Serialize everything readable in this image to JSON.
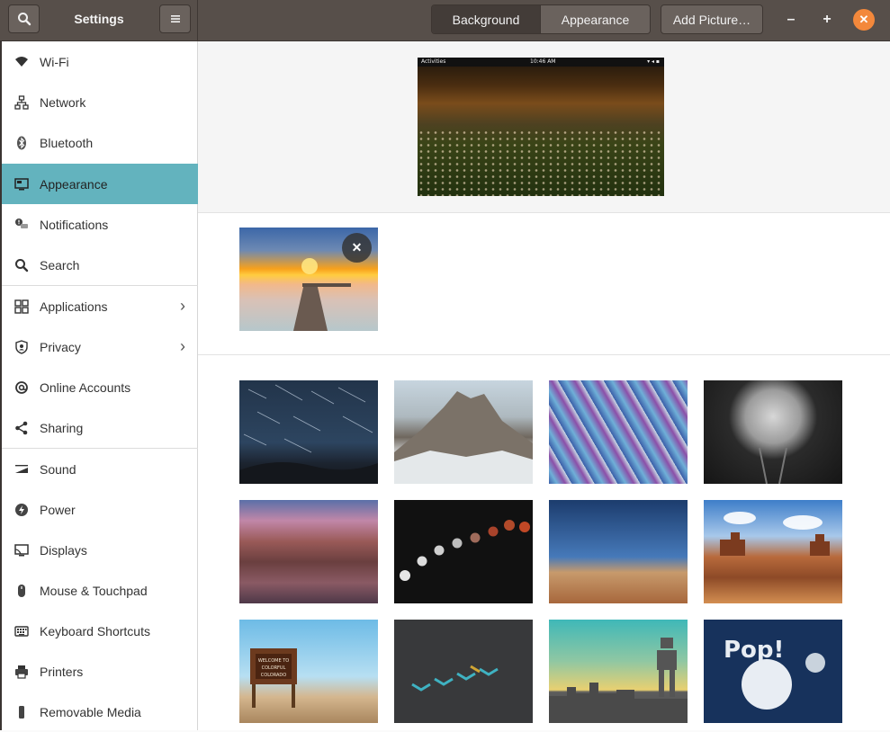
{
  "header": {
    "title": "Settings",
    "tabs": [
      {
        "label": "Background",
        "active": true
      },
      {
        "label": "Appearance",
        "active": false
      }
    ],
    "add_picture_label": "Add Picture…",
    "minimize_glyph": "–",
    "maximize_glyph": "+",
    "close_glyph": "✕",
    "close_color": "#f3883b"
  },
  "sidebar": {
    "accent_color": "#63b3be",
    "items": [
      {
        "label": "Wi-Fi",
        "icon": "wifi-icon",
        "active": false,
        "chevron": false
      },
      {
        "label": "Network",
        "icon": "network-icon",
        "active": false,
        "chevron": false
      },
      {
        "label": "Bluetooth",
        "icon": "bluetooth-icon",
        "active": false,
        "chevron": false
      },
      {
        "label": "Appearance",
        "icon": "monitor-icon",
        "active": true,
        "chevron": false
      },
      {
        "label": "Notifications",
        "icon": "notifications-icon",
        "active": false,
        "chevron": false
      },
      {
        "label": "Search",
        "icon": "search-icon",
        "active": false,
        "chevron": false
      },
      {
        "label": "Applications",
        "icon": "applications-icon",
        "active": false,
        "chevron": true
      },
      {
        "label": "Privacy",
        "icon": "privacy-icon",
        "active": false,
        "chevron": true
      },
      {
        "label": "Online Accounts",
        "icon": "online-accounts-icon",
        "active": false,
        "chevron": false
      },
      {
        "label": "Sharing",
        "icon": "sharing-icon",
        "active": false,
        "chevron": false
      },
      {
        "label": "Sound",
        "icon": "sound-icon",
        "active": false,
        "chevron": false
      },
      {
        "label": "Power",
        "icon": "power-icon",
        "active": false,
        "chevron": false
      },
      {
        "label": "Displays",
        "icon": "displays-icon",
        "active": false,
        "chevron": false
      },
      {
        "label": "Mouse & Touchpad",
        "icon": "mouse-icon",
        "active": false,
        "chevron": false
      },
      {
        "label": "Keyboard Shortcuts",
        "icon": "keyboard-icon",
        "active": false,
        "chevron": false
      },
      {
        "label": "Printers",
        "icon": "printer-icon",
        "active": false,
        "chevron": false
      },
      {
        "label": "Removable Media",
        "icon": "removable-media-icon",
        "active": false,
        "chevron": false
      }
    ]
  },
  "preview": {
    "topbar_left": "Activities",
    "topbar_center": "10:46 AM"
  },
  "custom_wallpapers": [
    {
      "name": "sunset-pier",
      "deletable": true
    }
  ],
  "wallpapers": [
    "star-trails",
    "snowy-mountains",
    "geodesic-dome",
    "satellite-dish",
    "grand-canyon",
    "lunar-eclipse",
    "desert-dunes",
    "monument-valley",
    "colorado-sign",
    "chevron-pattern",
    "robot-silhouette",
    "pop-planet"
  ],
  "colorado_sign_text": [
    "WELCOME TO",
    "COLORFUL",
    "COLORADO"
  ],
  "pop_text": "Pop!"
}
